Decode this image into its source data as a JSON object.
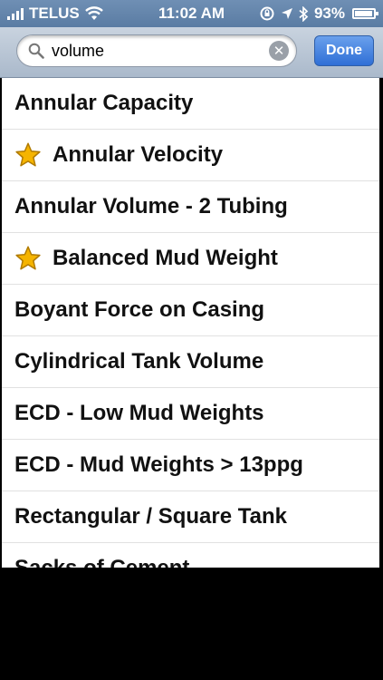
{
  "status_bar": {
    "carrier": "TELUS",
    "time": "11:02 AM",
    "battery": "93%",
    "battery_level": 0.93
  },
  "search": {
    "value": "volume",
    "placeholder": "",
    "done_label": "Done"
  },
  "results": [
    {
      "label": "Annular Capacity",
      "favorite": false
    },
    {
      "label": "Annular Velocity",
      "favorite": true
    },
    {
      "label": "Annular Volume - 2 Tubing",
      "favorite": false
    },
    {
      "label": "Balanced Mud Weight",
      "favorite": true
    },
    {
      "label": "Boyant Force on Casing",
      "favorite": false
    },
    {
      "label": "Cylindrical Tank Volume",
      "favorite": false
    },
    {
      "label": "ECD - Low Mud Weights",
      "favorite": false
    },
    {
      "label": "ECD - Mud Weights > 13ppg",
      "favorite": false
    },
    {
      "label": "Rectangular / Square Tank",
      "favorite": false
    },
    {
      "label": "Sacks of Cement",
      "favorite": false
    }
  ],
  "colors": {
    "star": "#f5b400",
    "star_stroke": "#b07a00"
  }
}
